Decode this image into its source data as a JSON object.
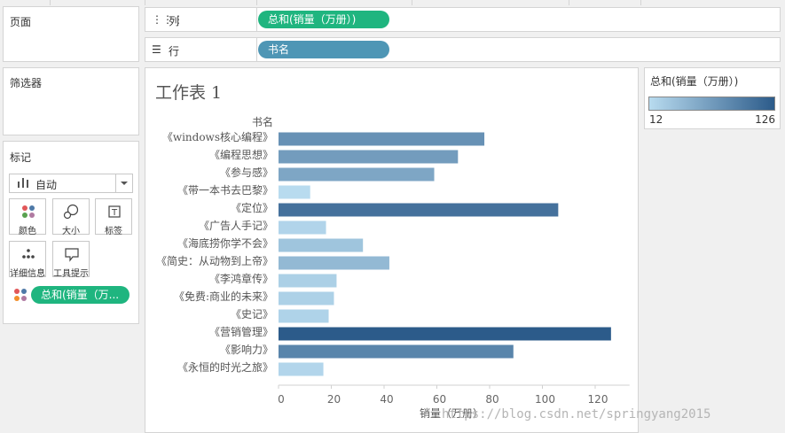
{
  "sections": {
    "pages": "页面",
    "filters": "筛选器",
    "marks": "标记"
  },
  "columns_shelf": {
    "label": "列",
    "icon": "columns-icon",
    "pill": "总和(销量（万册）)"
  },
  "rows_shelf": {
    "label": "行",
    "icon": "rows-icon",
    "pill": "书名"
  },
  "marks": {
    "type": "自动",
    "buttons": [
      "颜色",
      "大小",
      "标签",
      "详细信息",
      "工具提示"
    ],
    "color_pill": "总和(销量（万..."
  },
  "view_title": "工作表 1",
  "legend": {
    "title": "总和(销量（万册）)",
    "min": "12",
    "max": "126",
    "color_low": "#b8dbef",
    "color_high": "#2c5b8a"
  },
  "watermark": "https://blog.csdn.net/springyang2015",
  "chart_data": {
    "type": "bar",
    "orientation": "horizontal",
    "category_header": "书名",
    "categories": [
      "《windows核心编程》",
      "《编程思想》",
      "《参与感》",
      "《带一本书去巴黎》",
      "《定位》",
      "《广告人手记》",
      "《海底捞你学不会》",
      "《简史：从动物到上帝》",
      "《李鸿章传》",
      "《免费:商业的未来》",
      "《史记》",
      "《营销管理》",
      "《影响力》",
      "《永恒的时光之旅》"
    ],
    "values": [
      78,
      68,
      59,
      12,
      106,
      18,
      32,
      42,
      22,
      21,
      19,
      126,
      89,
      17
    ],
    "xlabel": "销量（万册）",
    "xlim": [
      0,
      133
    ],
    "xticks": [
      "0",
      "20",
      "40",
      "60",
      "80",
      "100",
      "120"
    ],
    "grid": false
  }
}
